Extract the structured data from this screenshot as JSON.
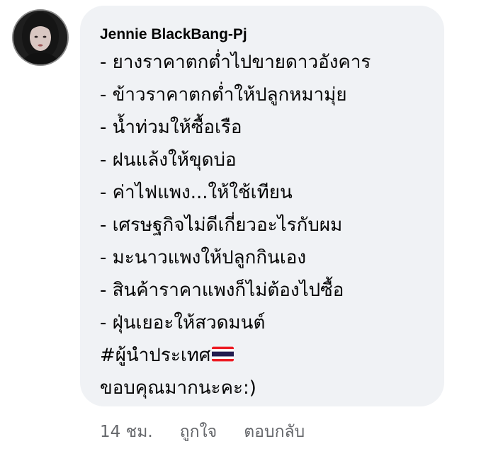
{
  "comment": {
    "author": "Jennie BlackBang-Pj",
    "lines": [
      "- ยางราคาตกต่ำไปขายดาวอังคาร",
      "- ข้าวราคาตกต่ำให้ปลูกหมามุ่ย",
      "- น้ำท่วมให้ซื้อเรือ",
      "- ฝนแล้งให้ขุดบ่อ",
      "- ค่าไฟแพง...ให้ใช้เทียน",
      "- เศรษฐกิจไม่ดีเกี่ยวอะไรกับผม",
      "- มะนาวแพงให้ปลูกกินเอง",
      "- สินค้าราคาแพงก็ไม่ต้องไปซื้อ",
      "- ฝุ่นเยอะให้สวดมนต์"
    ],
    "hashtag": "#ผู้นำประเทศ",
    "closing": "ขอบคุณมากนะคะ:)"
  },
  "actions": {
    "time": "14 ชม.",
    "like": "ถูกใจ",
    "reply": "ตอบกลับ"
  },
  "icons": {
    "avatar": "profile-photo",
    "flag": "thailand-flag-emoji"
  }
}
